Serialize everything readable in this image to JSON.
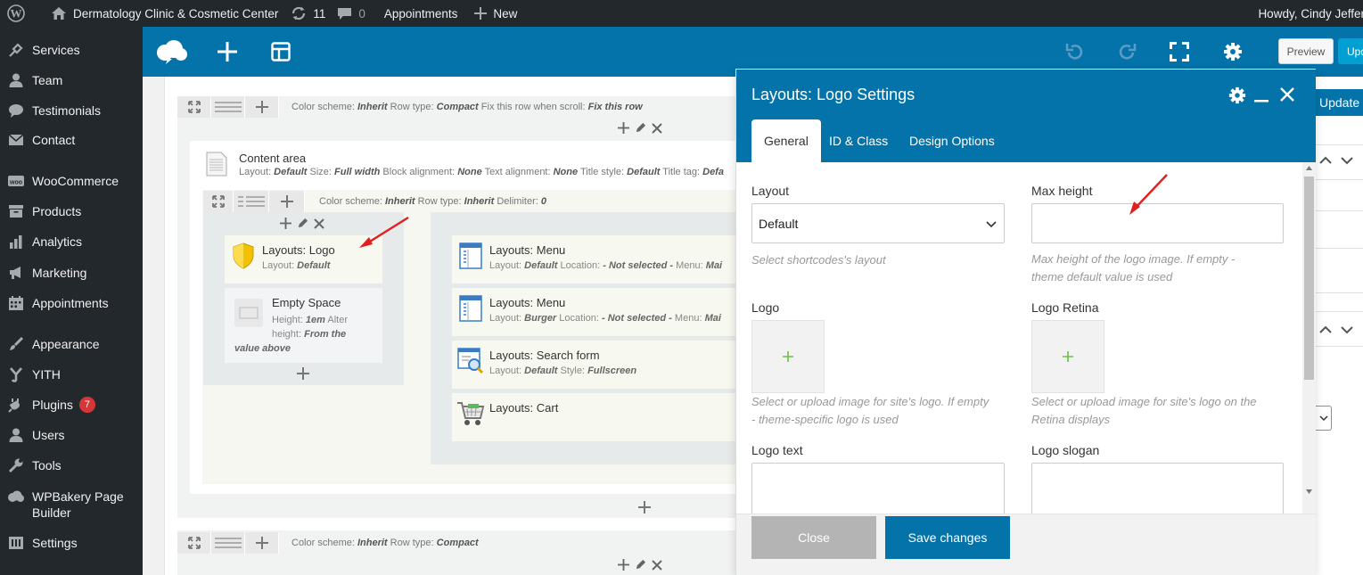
{
  "admin_bar": {
    "site_name": "Dermatology Clinic & Cosmetic Center",
    "updates_count": "11",
    "comments_count": "0",
    "appointments": "Appointments",
    "new": "New",
    "howdy": "Howdy, Cindy Jeffer"
  },
  "sidebar": {
    "items": [
      {
        "label": "Services",
        "icon": "pin-icon"
      },
      {
        "label": "Team",
        "icon": "user-icon"
      },
      {
        "label": "Testimonials",
        "icon": "comment-icon"
      },
      {
        "label": "Contact",
        "icon": "mail-icon"
      },
      {
        "label": "WooCommerce",
        "icon": "woo-icon"
      },
      {
        "label": "Products",
        "icon": "archive-icon"
      },
      {
        "label": "Analytics",
        "icon": "chart-icon"
      },
      {
        "label": "Marketing",
        "icon": "megaphone-icon"
      },
      {
        "label": "Appointments",
        "icon": "calendar-icon"
      },
      {
        "label": "Appearance",
        "icon": "brush-icon"
      },
      {
        "label": "YITH",
        "icon": "yith-icon"
      },
      {
        "label": "Plugins",
        "icon": "plugin-icon",
        "badge": "7"
      },
      {
        "label": "Users",
        "icon": "users-icon"
      },
      {
        "label": "Tools",
        "icon": "wrench-icon"
      },
      {
        "label": "WPBakery Page Builder",
        "icon": "cloud-icon"
      },
      {
        "label": "Settings",
        "icon": "settings-icon"
      }
    ]
  },
  "toolbar": {
    "preview": "Preview",
    "update_partial": "Upd",
    "update": "Update"
  },
  "rows": {
    "row1_meta": [
      {
        "k": "Color scheme:",
        "v": "Inherit"
      },
      {
        "k": "Row type:",
        "v": "Compact"
      },
      {
        "k": "Fix this row when scroll:",
        "v": "Fix this row"
      }
    ],
    "content_area": {
      "title": "Content area",
      "meta": [
        {
          "k": "Layout:",
          "v": "Default"
        },
        {
          "k": "Size:",
          "v": "Full width"
        },
        {
          "k": "Block alignment:",
          "v": "None"
        },
        {
          "k": "Text alignment:",
          "v": "None"
        },
        {
          "k": "Title style:",
          "v": "Default"
        },
        {
          "k": "Title tag:",
          "v": "Defa"
        }
      ]
    },
    "inner_meta": [
      {
        "k": "Color scheme:",
        "v": "Inherit"
      },
      {
        "k": "Row type:",
        "v": "Inherit"
      },
      {
        "k": "Delimiter:",
        "v": "0"
      }
    ],
    "row2_meta": [
      {
        "k": "Color scheme:",
        "v": "Inherit"
      },
      {
        "k": "Row type:",
        "v": "Compact"
      }
    ]
  },
  "elements": {
    "logo": {
      "title": "Layouts: Logo",
      "k1": "Layout:",
      "v1": "Default"
    },
    "empty_space": {
      "title": "Empty Space",
      "k1": "Height:",
      "v1": "1em",
      "k2": "Alter",
      "k3": "height:",
      "v3": "From the",
      "v4": "value above"
    },
    "menu1": {
      "title": "Layouts: Menu",
      "k1": "Layout:",
      "v1": "Default",
      "k2": "Location:",
      "v2": "- Not selected -",
      "k3": "Menu:",
      "v3": "Mai"
    },
    "menu2": {
      "title": "Layouts: Menu",
      "k1": "Layout:",
      "v1": "Burger",
      "k2": "Location:",
      "v2": "- Not selected -",
      "k3": "Menu:",
      "v3": "Mai"
    },
    "search": {
      "title": "Layouts: Search form",
      "k1": "Layout:",
      "v1": "Default",
      "k2": "Style:",
      "v2": "Fullscreen"
    },
    "cart": {
      "title": "Layouts: Cart"
    }
  },
  "modal": {
    "title": "Layouts: Logo Settings",
    "tabs": [
      "General",
      "ID & Class",
      "Design Options"
    ],
    "fields": {
      "layout_label": "Layout",
      "layout_value": "Default",
      "layout_hint": "Select shortcodes's layout",
      "max_height_label": "Max height",
      "max_height_value": "",
      "max_height_hint_1": "Max height of the logo image. If empty -",
      "max_height_hint_2": "theme default value is used",
      "logo_label": "Logo",
      "logo_hint_1": "Select or upload image for site's logo. If empty",
      "logo_hint_2": "- theme-specific logo is used",
      "logo_retina_label": "Logo Retina",
      "logo_retina_hint_1": "Select or upload image for site's logo on the",
      "logo_retina_hint_2": "Retina displays",
      "logo_text_label": "Logo text",
      "logo_slogan_label": "Logo slogan"
    },
    "close": "Close",
    "save": "Save changes"
  },
  "colors": {
    "admin_bar": "#23282d",
    "builder_blue": "#0473aa",
    "update_blue": "#00a0d2",
    "arrow_red": "#e02020",
    "add_green": "#6cc04a"
  }
}
